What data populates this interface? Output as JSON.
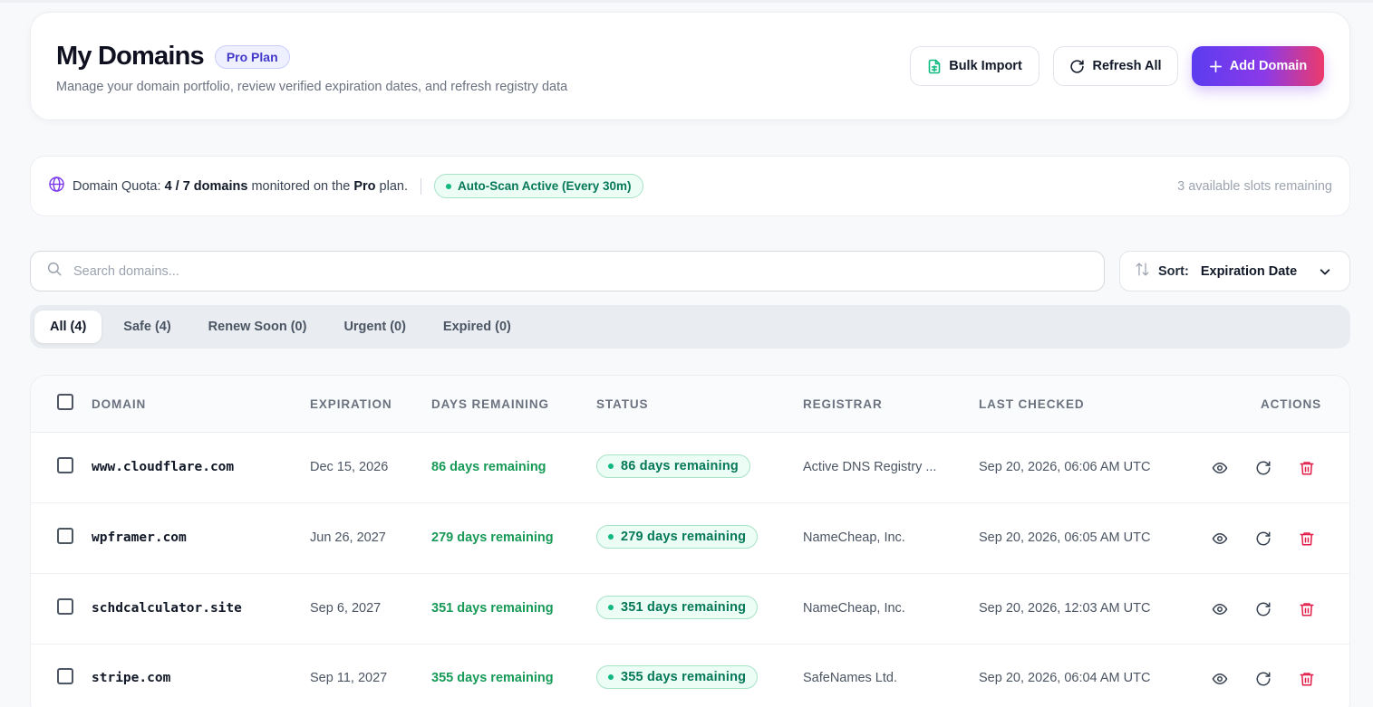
{
  "header": {
    "title": "My Domains",
    "plan_badge": "Pro Plan",
    "subtitle": "Manage your domain portfolio, review verified expiration dates, and refresh registry data",
    "buttons": {
      "bulk_import": "Bulk Import",
      "refresh_all": "Refresh All",
      "add_domain": "Add Domain"
    }
  },
  "quota": {
    "prefix": "Domain Quota:",
    "count": "4 / 7 domains",
    "middle": "monitored on the",
    "plan": "Pro",
    "suffix": "plan.",
    "scan_badge": "Auto-Scan Active (Every 30m)",
    "slots_remaining": "3 available slots remaining"
  },
  "search": {
    "placeholder": "Search domains...",
    "value": ""
  },
  "sort": {
    "label": "Sort:",
    "value": "Expiration Date"
  },
  "tabs": [
    {
      "label": "All (4)",
      "active": true
    },
    {
      "label": "Safe (4)",
      "active": false
    },
    {
      "label": "Renew Soon (0)",
      "active": false
    },
    {
      "label": "Urgent (0)",
      "active": false
    },
    {
      "label": "Expired (0)",
      "active": false
    }
  ],
  "table": {
    "columns": [
      "DOMAIN",
      "EXPIRATION",
      "DAYS REMAINING",
      "STATUS",
      "REGISTRAR",
      "LAST CHECKED",
      "ACTIONS"
    ],
    "rows": [
      {
        "domain": "www.cloudflare.com",
        "expiration": "Dec 15, 2026",
        "days": "86 days remaining",
        "status": "86 days remaining",
        "registrar": "Active DNS Registry ...",
        "last_checked": "Sep 20, 2026, 06:06 AM UTC"
      },
      {
        "domain": "wpframer.com",
        "expiration": "Jun 26, 2027",
        "days": "279 days remaining",
        "status": "279 days remaining",
        "registrar": "NameCheap, Inc.",
        "last_checked": "Sep 20, 2026, 06:05 AM UTC"
      },
      {
        "domain": "schdcalculator.site",
        "expiration": "Sep 6, 2027",
        "days": "351 days remaining",
        "status": "351 days remaining",
        "registrar": "NameCheap, Inc.",
        "last_checked": "Sep 20, 2026, 12:03 AM UTC"
      },
      {
        "domain": "stripe.com",
        "expiration": "Sep 11, 2027",
        "days": "355 days remaining",
        "status": "355 days remaining",
        "registrar": "SafeNames Ltd.",
        "last_checked": "Sep 20, 2026, 06:04 AM UTC"
      }
    ]
  },
  "colors": {
    "accent_start": "#5b3cf0",
    "accent_end": "#ec3a6b",
    "success": "#179a57",
    "danger": "#e11d48"
  },
  "icons": {
    "bulk_import": "file-spreadsheet-icon",
    "refresh_all": "refresh-icon",
    "add_domain": "plus-icon",
    "quota": "globe-icon",
    "search": "search-icon",
    "sort": "sort-arrows-icon",
    "sort_dropdown": "chevron-down-icon",
    "view": "eye-icon",
    "refresh_row": "refresh-icon",
    "delete": "trash-icon"
  }
}
